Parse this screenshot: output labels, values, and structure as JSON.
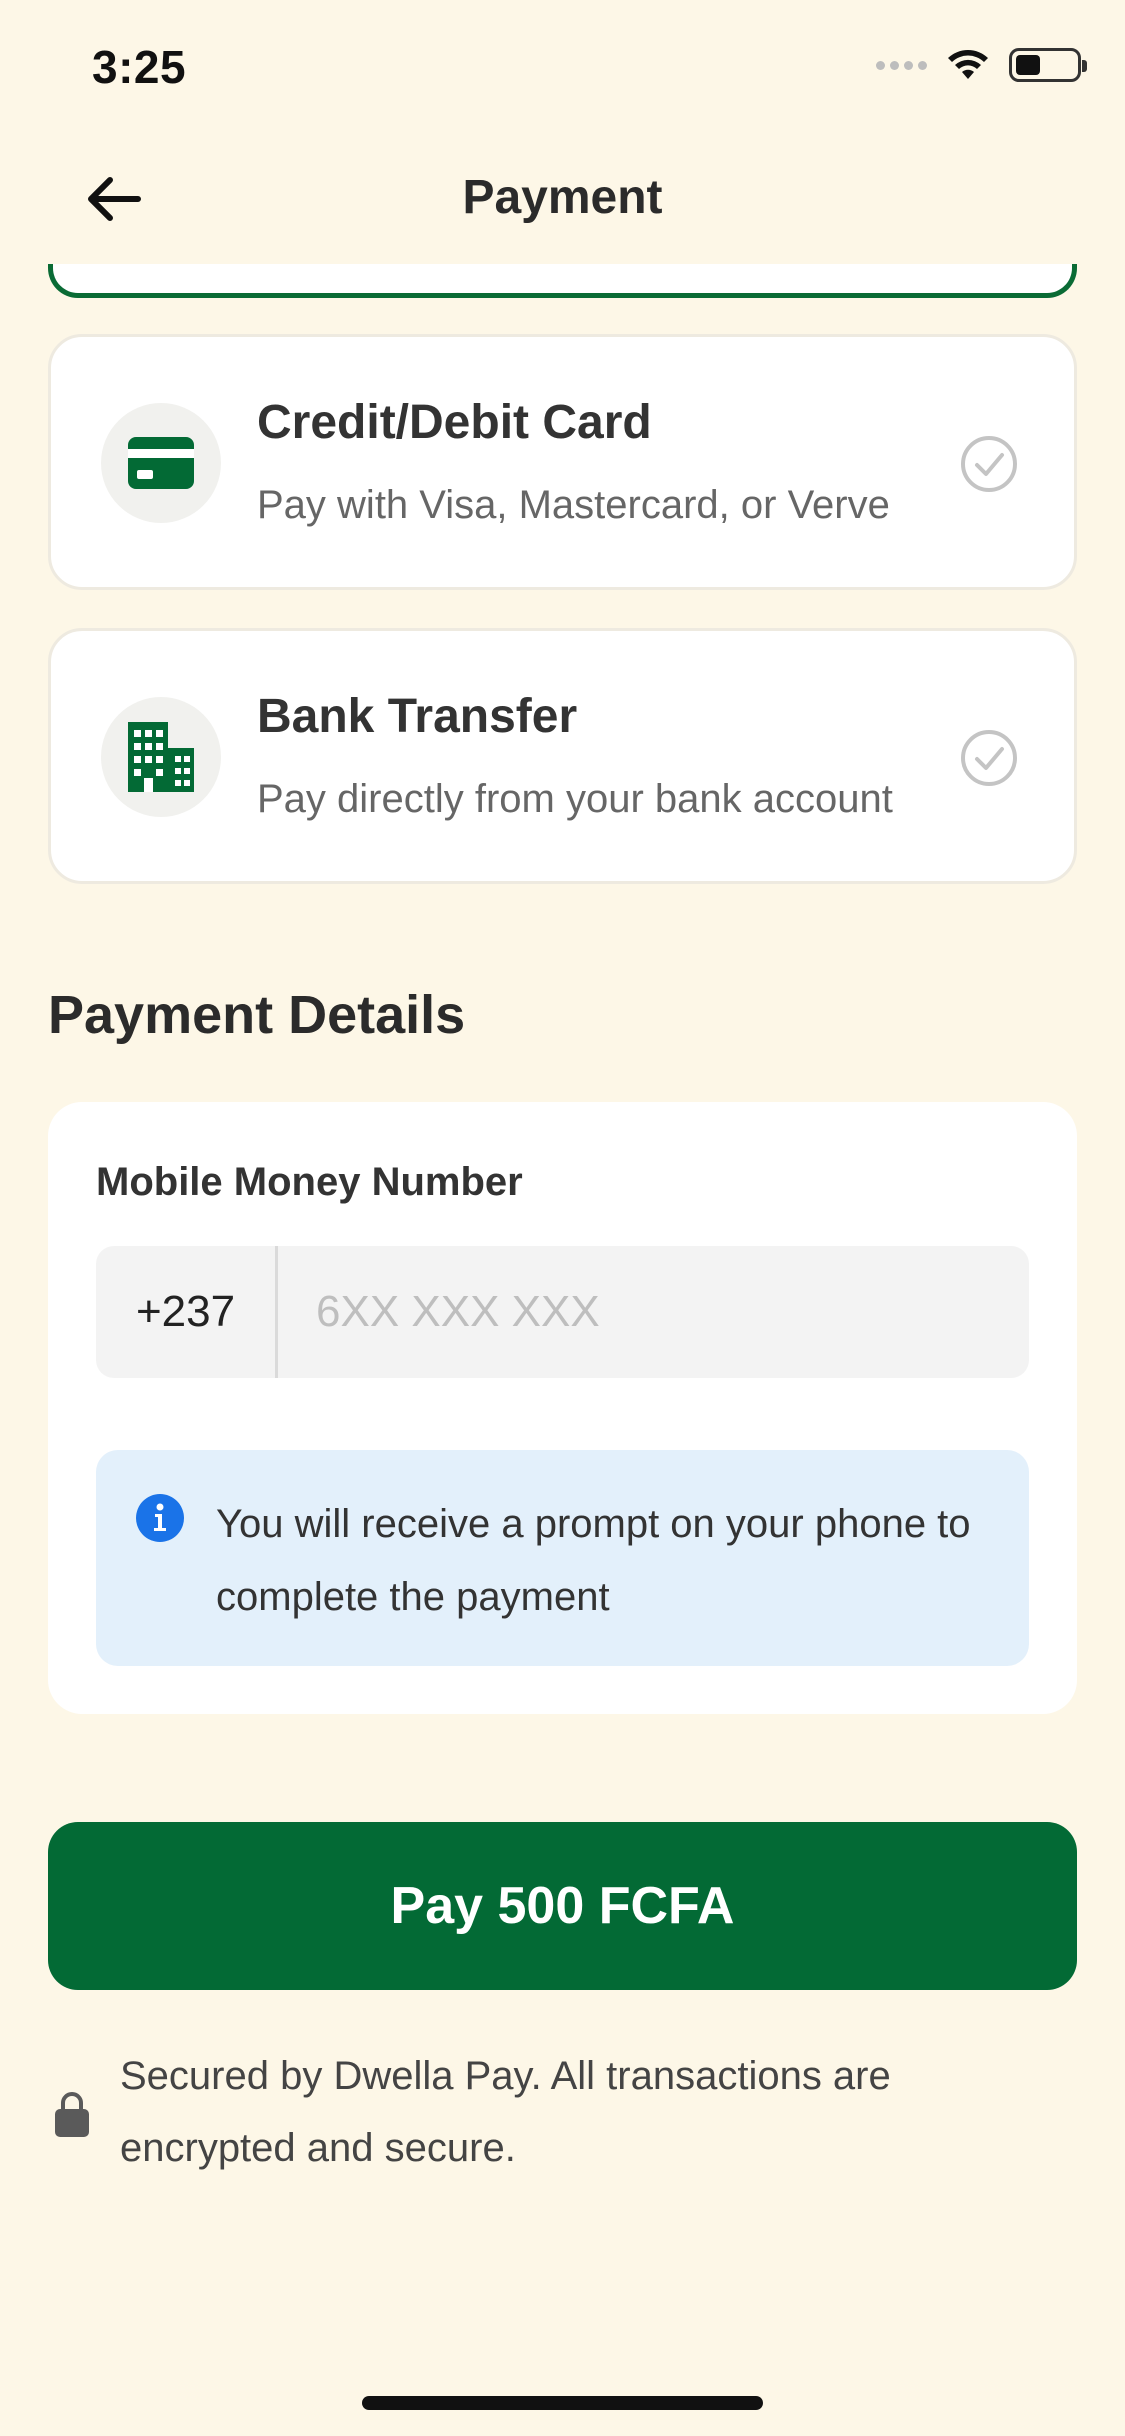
{
  "status_bar": {
    "time": "3:25"
  },
  "header": {
    "title": "Payment",
    "back_icon": "arrow-left-icon"
  },
  "payment_methods": [
    {
      "title": "Credit/Debit Card",
      "subtitle": "Pay with Visa, Mastercard, or Verve",
      "icon": "credit-card-icon",
      "selected": false
    },
    {
      "title": "Bank Transfer",
      "subtitle": "Pay directly from your bank account",
      "icon": "bank-building-icon",
      "selected": false
    }
  ],
  "details": {
    "section_title": "Payment Details",
    "field_label": "Mobile Money Number",
    "country_code": "+237",
    "phone_placeholder": "6XX XXX XXX",
    "phone_value": "",
    "info_text": "You will receive a prompt on your phone to complete the payment"
  },
  "pay_button": {
    "label": "Pay 500 FCFA"
  },
  "security_note": "Secured by Dwella Pay. All transactions are encrypted and secure.",
  "colors": {
    "background": "#FDF7E7",
    "brand_green": "#036A35",
    "info_background": "#E3F0FB",
    "info_icon": "#1A73E8"
  }
}
